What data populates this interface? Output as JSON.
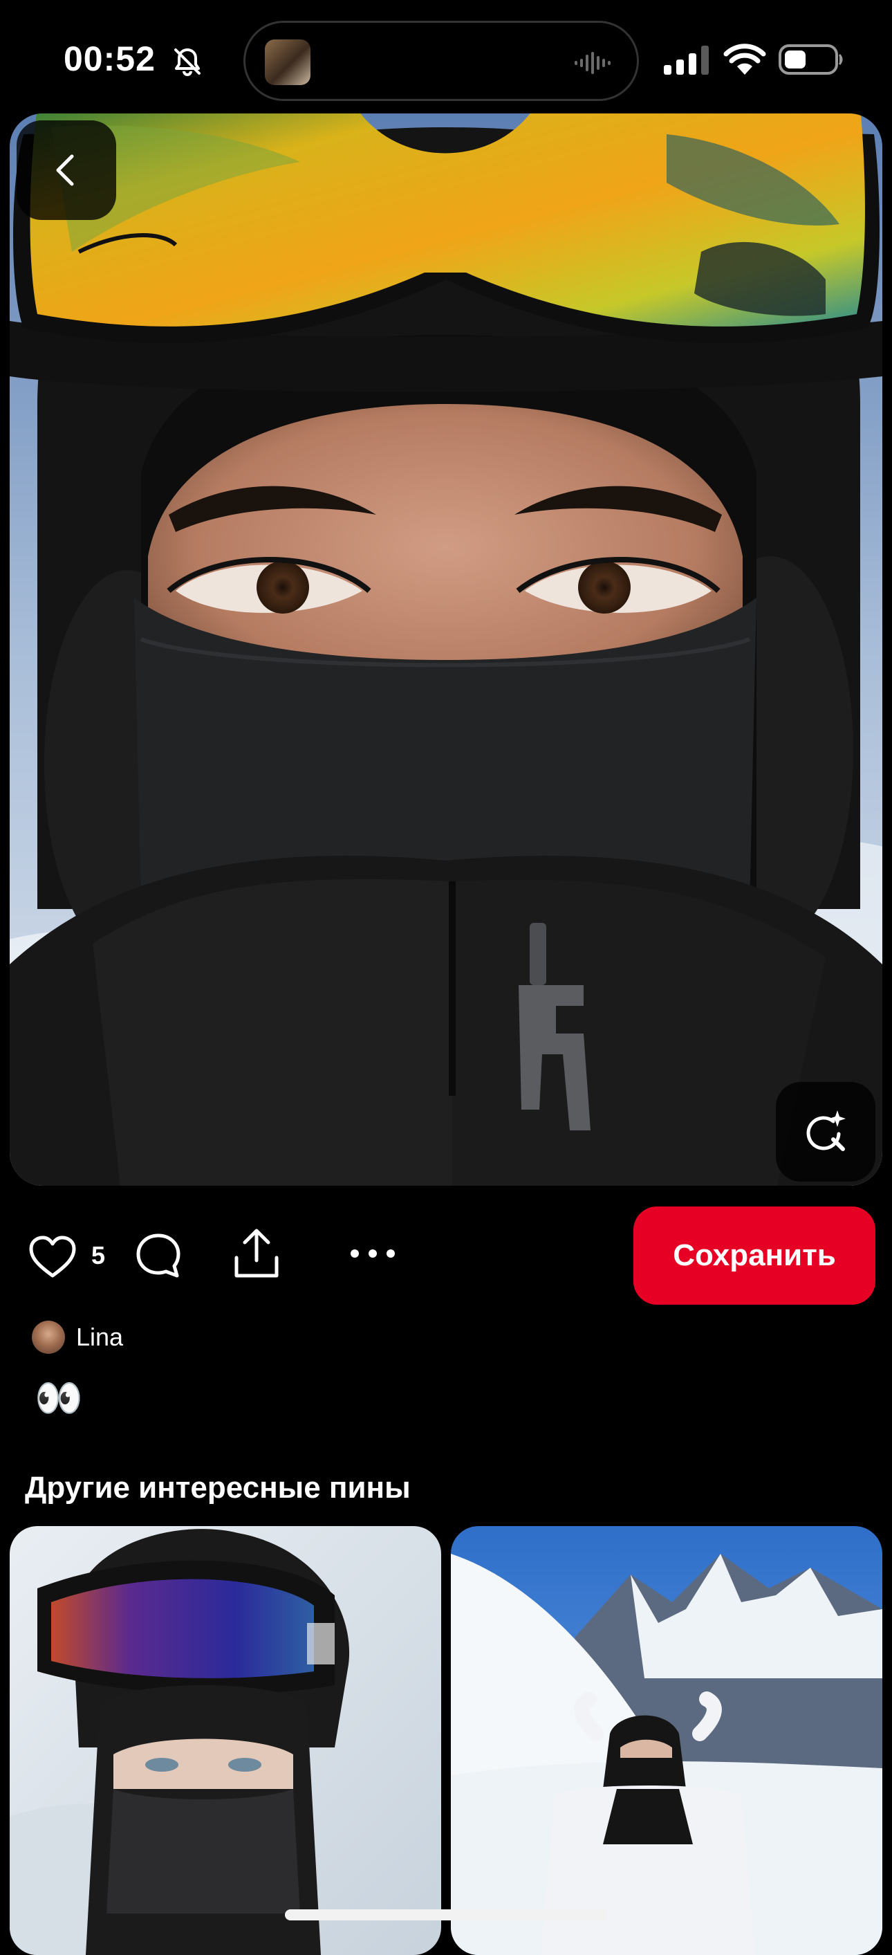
{
  "status_bar": {
    "time": "00:52",
    "icons": [
      "silent-mode-icon",
      "signal-icon",
      "wifi-icon",
      "battery-icon"
    ]
  },
  "pin": {
    "image_alt": "Selfie in ski helmet, mirrored orange goggles and black face mask",
    "like_count": "5",
    "save_label": "Сохранить",
    "author_name": "Lina",
    "description": "👀"
  },
  "more": {
    "title": "Другие интересные пины",
    "pins": [
      {
        "alt": "Ski selfie with helmet, purple goggles and balaclava"
      },
      {
        "alt": "Person in balaclava in front of snowy mountains"
      }
    ]
  },
  "colors": {
    "save_button": "#e60023",
    "background": "#000000",
    "text": "#ffffff"
  }
}
